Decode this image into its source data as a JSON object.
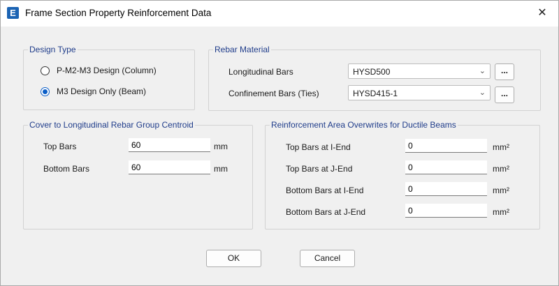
{
  "window": {
    "title": "Frame Section Property Reinforcement Data",
    "app_icon_letter": "E",
    "close_glyph": "✕"
  },
  "design_type": {
    "legend": "Design Type",
    "options": [
      {
        "label": "P-M2-M3 Design  (Column)",
        "selected": false
      },
      {
        "label": "M3 Design Only  (Beam)",
        "selected": true
      }
    ]
  },
  "rebar_material": {
    "legend": "Rebar Material",
    "longitudinal_label": "Longitudinal Bars",
    "longitudinal_value": "HYSD500",
    "confinement_label": "Confinement Bars (Ties)",
    "confinement_value": "HYSD415-1",
    "browse_label": "..."
  },
  "cover": {
    "legend": "Cover to Longitudinal Rebar Group Centroid",
    "top_label": "Top Bars",
    "top_value": "60",
    "bottom_label": "Bottom  Bars",
    "bottom_value": "60",
    "unit": "mm"
  },
  "overwrites": {
    "legend": "Reinforcement Area Overwrites for Ductile Beams",
    "unit": "mm²",
    "rows": [
      {
        "label": "Top Bars at I-End",
        "value": "0"
      },
      {
        "label": "Top Bars at J-End",
        "value": "0"
      },
      {
        "label": "Bottom Bars at I-End",
        "value": "0"
      },
      {
        "label": "Bottom Bars at J-End",
        "value": "0"
      }
    ]
  },
  "buttons": {
    "ok": "OK",
    "cancel": "Cancel"
  },
  "colors": {
    "legend_text": "#1f3c8a",
    "radio_accent": "#0b5ec7",
    "app_icon": "#1b63b3"
  }
}
